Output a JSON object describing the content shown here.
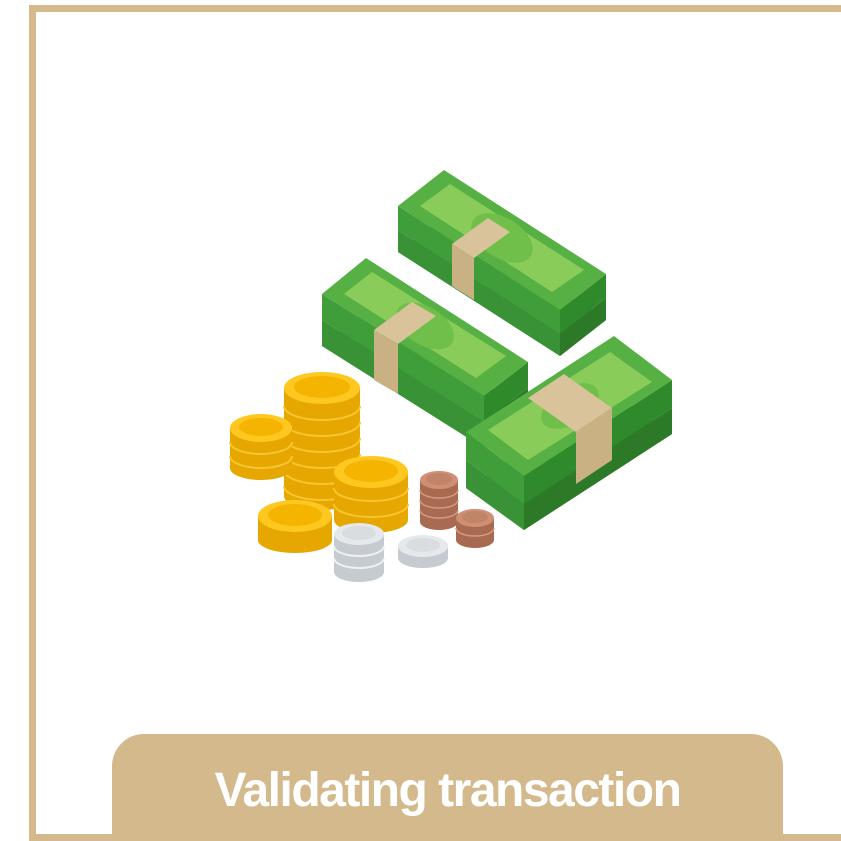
{
  "caption": {
    "text": "Validating transaction"
  },
  "illustration": {
    "icon": "money-stack-icon",
    "colors": {
      "frame": "#d3b98b",
      "bill": "#3f9e3a",
      "bill_top": "#6fbf4a",
      "band": "#d8c39a",
      "gold": "#f4b400",
      "silver": "#d9dde0",
      "copper": "#c08468"
    }
  }
}
